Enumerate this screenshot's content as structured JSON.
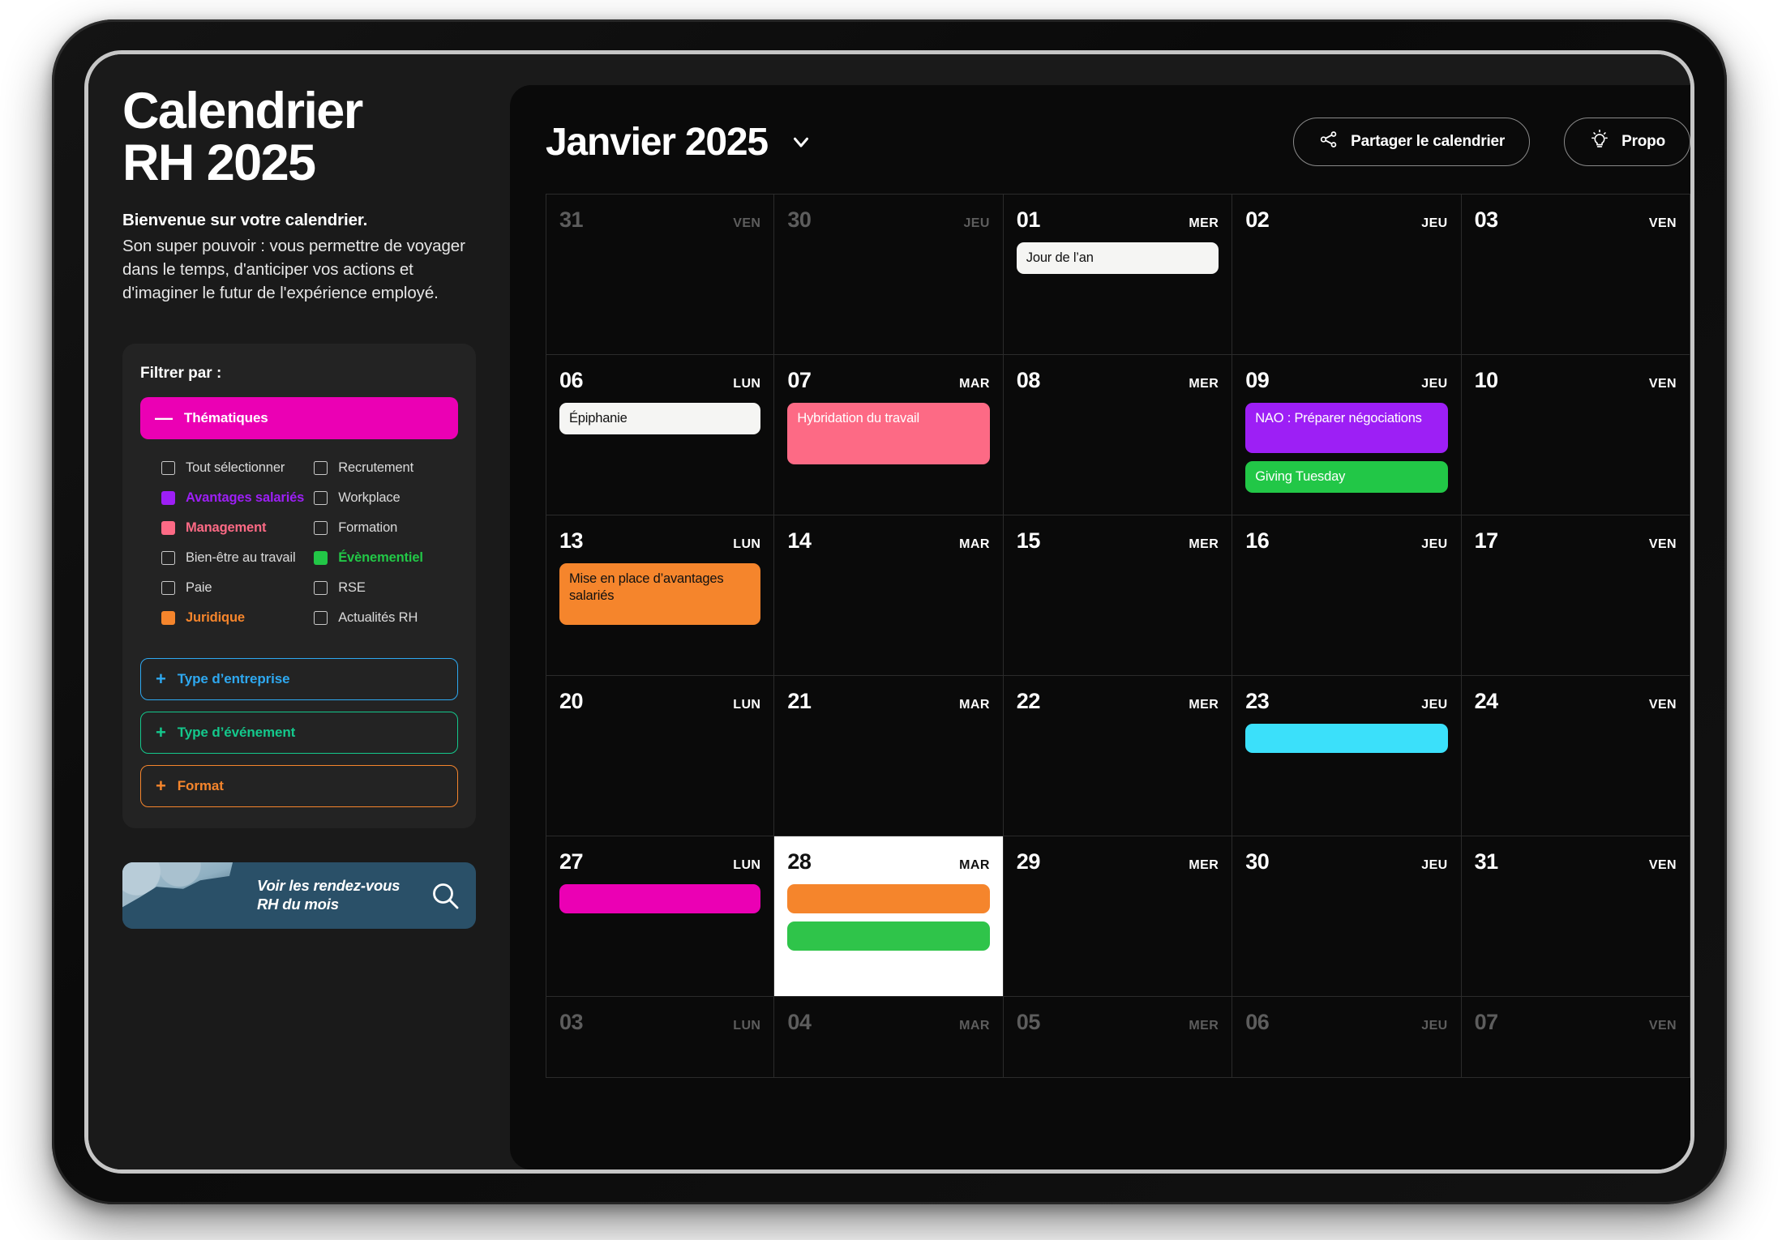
{
  "sidebar": {
    "title_line1": "Calendrier",
    "title_line2": "RH 2025",
    "lede_strong": "Bienvenue sur votre calendrier.",
    "lede": "Son super pouvoir : vous permettre de voyager dans le temps, d'anticiper vos actions et d'imaginer le futur de l'expérience employé.",
    "filter_title": "Filtrer par :",
    "accordions": [
      {
        "label": "Thématiques",
        "sign": "—",
        "state": "open",
        "color": "#EB00B4"
      },
      {
        "label": "Type d’entreprise",
        "sign": "+",
        "state": "closed",
        "color": "#2EA8F0"
      },
      {
        "label": "Type d’événement",
        "sign": "+",
        "state": "closed",
        "color": "#14C88C"
      },
      {
        "label": "Format",
        "sign": "+",
        "state": "closed",
        "color": "#F5852C"
      }
    ],
    "checkboxes": [
      {
        "label": "Tout sélectionner",
        "checked": false,
        "color": ""
      },
      {
        "label": "Recrutement",
        "checked": false,
        "color": ""
      },
      {
        "label": "Avantages salariés",
        "checked": true,
        "color": "#9D1FF5"
      },
      {
        "label": "Workplace",
        "checked": false,
        "color": ""
      },
      {
        "label": "Management",
        "checked": true,
        "color": "#FD6A85"
      },
      {
        "label": "Formation",
        "checked": false,
        "color": ""
      },
      {
        "label": "Bien-être au travail",
        "checked": false,
        "color": ""
      },
      {
        "label": "Évènementiel",
        "checked": true,
        "color": "#22C747"
      },
      {
        "label": "Paie",
        "checked": false,
        "color": ""
      },
      {
        "label": "RSE",
        "checked": false,
        "color": ""
      },
      {
        "label": "Juridique",
        "checked": true,
        "color": "#F5852C"
      },
      {
        "label": "Actualités RH",
        "checked": false,
        "color": ""
      }
    ],
    "cta": {
      "line1": "Voir les rendez-vous",
      "line2": "RH du mois",
      "icon": "search-icon"
    }
  },
  "calendar": {
    "month_label": "Janvier 2025",
    "dropdown_icon": "chevron-down-icon",
    "actions": [
      {
        "label": "Partager le calendrier",
        "icon": "share-nodes-icon"
      },
      {
        "label": "Propo",
        "icon": "lightbulb-icon"
      }
    ],
    "weeks": [
      [
        {
          "day": "31",
          "dow": "VEN",
          "muted": true,
          "today": false,
          "events": []
        },
        {
          "day": "30",
          "dow": "JEU",
          "muted": true,
          "today": false,
          "events": []
        },
        {
          "day": "01",
          "dow": "MER",
          "muted": false,
          "today": false,
          "events": [
            {
              "title": "Jour de l’an",
              "bg": "#F5F5F3",
              "fg": "#111111"
            }
          ]
        },
        {
          "day": "02",
          "dow": "JEU",
          "muted": false,
          "today": false,
          "events": []
        },
        {
          "day": "03",
          "dow": "VEN",
          "muted": false,
          "today": false,
          "events": []
        }
      ],
      [
        {
          "day": "06",
          "dow": "LUN",
          "muted": false,
          "today": false,
          "events": [
            {
              "title": "Épiphanie",
              "bg": "#F5F5F3",
              "fg": "#111111"
            }
          ]
        },
        {
          "day": "07",
          "dow": "MAR",
          "muted": false,
          "today": false,
          "events": [
            {
              "title": "Hybridation du travail",
              "bg": "#FD6A85",
              "fg": "#ffffff",
              "tall": true
            }
          ]
        },
        {
          "day": "08",
          "dow": "MER",
          "muted": false,
          "today": false,
          "events": []
        },
        {
          "day": "09",
          "dow": "JEU",
          "muted": false,
          "today": false,
          "events": [
            {
              "title": "NAO : Préparer négociations",
              "bg": "#9D1FF5",
              "fg": "#ffffff",
              "tall": true
            },
            {
              "title": "Giving Tuesday",
              "bg": "#22C747",
              "fg": "#ffffff"
            }
          ]
        },
        {
          "day": "10",
          "dow": "VEN",
          "muted": false,
          "today": false,
          "events": []
        }
      ],
      [
        {
          "day": "13",
          "dow": "LUN",
          "muted": false,
          "today": false,
          "events": [
            {
              "title": "Mise en place d’avantages salariés",
              "bg": "#F5852C",
              "fg": "#111111",
              "tall": true
            }
          ]
        },
        {
          "day": "14",
          "dow": "MAR",
          "muted": false,
          "today": false,
          "events": []
        },
        {
          "day": "15",
          "dow": "MER",
          "muted": false,
          "today": false,
          "events": []
        },
        {
          "day": "16",
          "dow": "JEU",
          "muted": false,
          "today": false,
          "events": []
        },
        {
          "day": "17",
          "dow": "VEN",
          "muted": false,
          "today": false,
          "events": []
        }
      ],
      [
        {
          "day": "20",
          "dow": "LUN",
          "muted": false,
          "today": false,
          "events": []
        },
        {
          "day": "21",
          "dow": "MAR",
          "muted": false,
          "today": false,
          "events": []
        },
        {
          "day": "22",
          "dow": "MER",
          "muted": false,
          "today": false,
          "events": []
        },
        {
          "day": "23",
          "dow": "JEU",
          "muted": false,
          "today": false,
          "events": [
            {
              "title": "",
              "bg": "#3BE0FA",
              "fg": "#111111"
            }
          ]
        },
        {
          "day": "24",
          "dow": "VEN",
          "muted": false,
          "today": false,
          "events": []
        }
      ],
      [
        {
          "day": "27",
          "dow": "LUN",
          "muted": false,
          "today": false,
          "events": [
            {
              "title": "",
              "bg": "#EB00B4",
              "fg": "#ffffff"
            }
          ]
        },
        {
          "day": "28",
          "dow": "MAR",
          "muted": false,
          "today": true,
          "events": [
            {
              "title": "",
              "bg": "#F5852C",
              "fg": "#111111"
            },
            {
              "title": "",
              "bg": "#2FC44A",
              "fg": "#ffffff"
            }
          ]
        },
        {
          "day": "29",
          "dow": "MER",
          "muted": false,
          "today": false,
          "events": []
        },
        {
          "day": "30",
          "dow": "JEU",
          "muted": false,
          "today": false,
          "events": []
        },
        {
          "day": "31",
          "dow": "VEN",
          "muted": false,
          "today": false,
          "events": []
        }
      ],
      [
        {
          "day": "03",
          "dow": "LUN",
          "muted": true,
          "today": false,
          "events": []
        },
        {
          "day": "04",
          "dow": "MAR",
          "muted": true,
          "today": false,
          "events": []
        },
        {
          "day": "05",
          "dow": "MER",
          "muted": true,
          "today": false,
          "events": []
        },
        {
          "day": "06",
          "dow": "JEU",
          "muted": true,
          "today": false,
          "events": []
        },
        {
          "day": "07",
          "dow": "VEN",
          "muted": true,
          "today": false,
          "events": []
        }
      ]
    ]
  }
}
